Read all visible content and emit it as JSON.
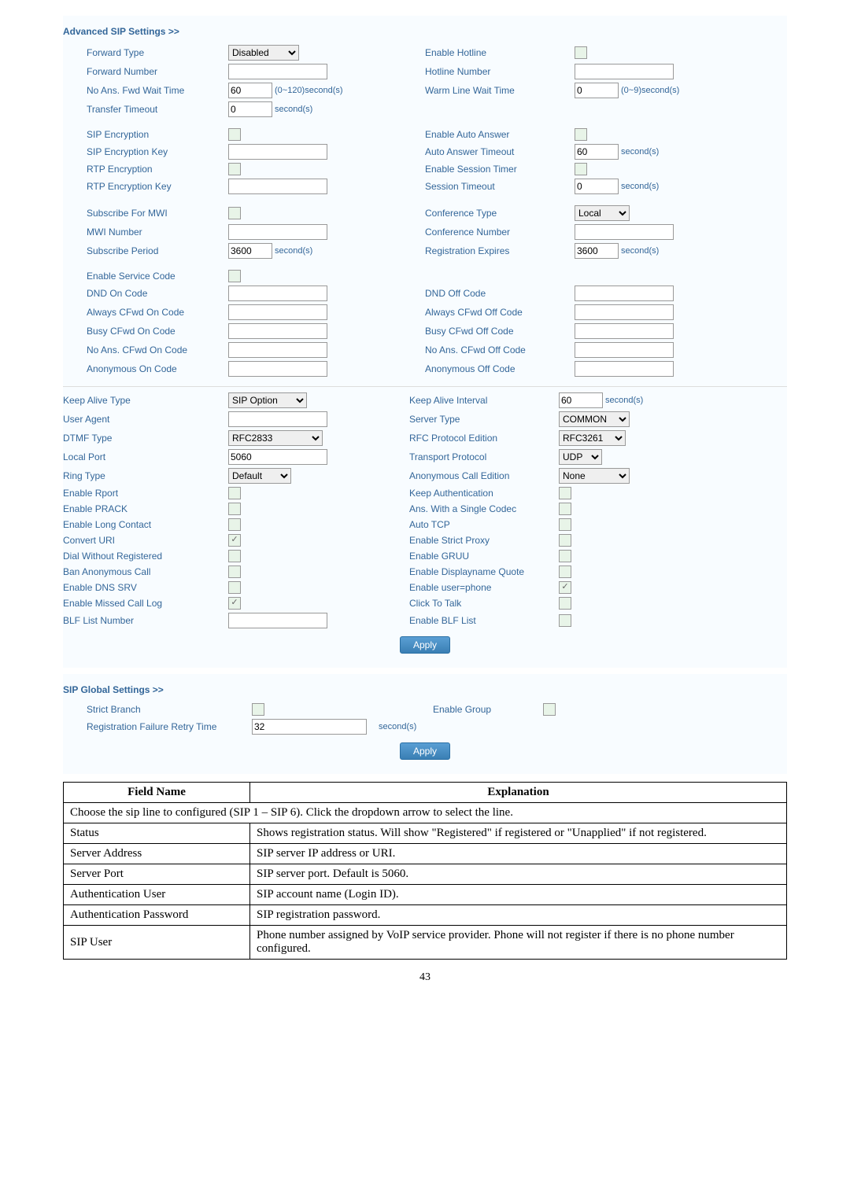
{
  "adv": {
    "header": "Advanced SIP Settings >>",
    "forward_type": "Forward Type",
    "forward_type_val": "Disabled",
    "forward_number": "Forward Number",
    "no_ans_fwd": "No Ans. Fwd Wait Time",
    "no_ans_fwd_val": "60",
    "no_ans_fwd_unit": "(0~120)second(s)",
    "transfer_timeout": "Transfer Timeout",
    "transfer_timeout_val": "0",
    "transfer_timeout_unit": "second(s)",
    "enable_hotline": "Enable Hotline",
    "hotline_number": "Hotline Number",
    "warm_line": "Warm Line Wait Time",
    "warm_line_val": "0",
    "warm_line_unit": "(0~9)second(s)",
    "sip_encryption": "SIP Encryption",
    "sip_encryption_key": "SIP Encryption Key",
    "rtp_encryption": "RTP Encryption",
    "rtp_encryption_key": "RTP Encryption Key",
    "enable_auto_answer": "Enable Auto Answer",
    "auto_answer_timeout": "Auto Answer Timeout",
    "auto_answer_timeout_val": "60",
    "enable_session_timer": "Enable Session Timer",
    "session_timeout": "Session Timeout",
    "session_timeout_val": "0",
    "seconds": "second(s)",
    "subscribe_mwi": "Subscribe For MWI",
    "mwi_number": "MWI Number",
    "subscribe_period": "Subscribe Period",
    "subscribe_period_val": "3600",
    "conference_type": "Conference Type",
    "conference_type_val": "Local",
    "conference_number": "Conference Number",
    "reg_expires": "Registration Expires",
    "reg_expires_val": "3600",
    "enable_service_code": "Enable Service Code",
    "dnd_on": "DND On Code",
    "dnd_off": "DND Off Code",
    "always_cfwd_on": "Always CFwd On Code",
    "always_cfwd_off": "Always CFwd Off Code",
    "busy_cfwd_on": "Busy CFwd On Code",
    "busy_cfwd_off": "Busy CFwd Off Code",
    "noans_cfwd_on": "No Ans. CFwd On Code",
    "noans_cfwd_off": "No Ans. CFwd Off Code",
    "anon_on": "Anonymous On Code",
    "anon_off": "Anonymous Off Code"
  },
  "ka": {
    "keep_alive_type": "Keep Alive Type",
    "keep_alive_type_val": "SIP Option",
    "user_agent": "User Agent",
    "dtmf_type": "DTMF Type",
    "dtmf_type_val": "RFC2833",
    "local_port": "Local Port",
    "local_port_val": "5060",
    "ring_type": "Ring Type",
    "ring_type_val": "Default",
    "enable_rport": "Enable Rport",
    "enable_prack": "Enable PRACK",
    "enable_long_contact": "Enable Long Contact",
    "convert_uri": "Convert URI",
    "dial_without_reg": "Dial Without Registered",
    "ban_anon": "Ban Anonymous Call",
    "enable_dns_srv": "Enable DNS SRV",
    "enable_missed": "Enable Missed Call Log",
    "blf_list": "BLF List Number",
    "keep_alive_interval": "Keep Alive Interval",
    "keep_alive_interval_val": "60",
    "server_type": "Server Type",
    "server_type_val": "COMMON",
    "rfc_protocol": "RFC Protocol Edition",
    "rfc_protocol_val": "RFC3261",
    "transport": "Transport Protocol",
    "transport_val": "UDP",
    "anon_call": "Anonymous Call Edition",
    "anon_call_val": "None",
    "keep_auth": "Keep Authentication",
    "ans_single": "Ans. With a Single Codec",
    "auto_tcp": "Auto TCP",
    "strict_proxy": "Enable Strict Proxy",
    "enable_gruu": "Enable GRUU",
    "enable_dq": "Enable Displayname Quote",
    "enable_up": "Enable user=phone",
    "click_talk": "Click To Talk",
    "enable_blf": "Enable BLF List",
    "apply": "Apply"
  },
  "sg": {
    "header": "SIP Global Settings >>",
    "strict_branch": "Strict Branch",
    "enable_group": "Enable Group",
    "reg_fail": "Registration Failure Retry Time",
    "reg_fail_val": "32",
    "seconds": "second(s)",
    "apply": "Apply"
  },
  "table": {
    "h1": "Field Name",
    "h2": "Explanation",
    "r0": "Choose the sip line to configured (SIP 1 – SIP 6).    Click the dropdown arrow to select the line.",
    "r1a": "Status",
    "r1b": "Shows registration status.  Will show \"Registered\" if registered or \"Unapplied\" if not registered.",
    "r2a": "Server Address",
    "r2b": "SIP server IP address or URI.",
    "r3a": "Server Port",
    "r3b": "SIP server port. Default is 5060.",
    "r4a": "Authentication User",
    "r4b": "SIP account name (Login ID).",
    "r5a": "Authentication Password",
    "r5b": "SIP registration password.",
    "r6a": "SIP User",
    "r6b": "Phone number assigned by VoIP service provider. Phone will not register if there is no phone number configured."
  },
  "page": "43"
}
